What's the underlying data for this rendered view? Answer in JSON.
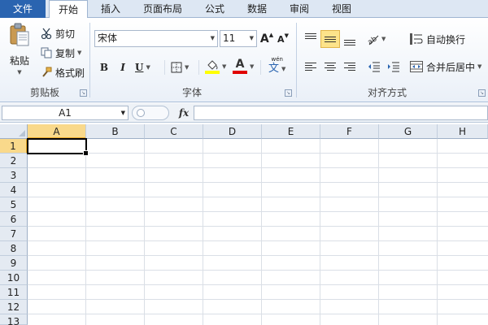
{
  "tabs": [
    {
      "id": "file",
      "label": "文件"
    },
    {
      "id": "home",
      "label": "开始"
    },
    {
      "id": "insert",
      "label": "插入"
    },
    {
      "id": "layout",
      "label": "页面布局"
    },
    {
      "id": "formula",
      "label": "公式"
    },
    {
      "id": "data",
      "label": "数据"
    },
    {
      "id": "review",
      "label": "审阅"
    },
    {
      "id": "view",
      "label": "视图"
    }
  ],
  "clipboard": {
    "paste": "粘贴",
    "cut": "剪切",
    "copy": "复制",
    "format_painter": "格式刷",
    "group_label": "剪贴板"
  },
  "font": {
    "name": "宋体",
    "size": "11",
    "bold": "B",
    "italic": "I",
    "underline": "U",
    "phonetic_top": "wén",
    "phonetic_main": "文",
    "font_color_letter": "A",
    "grow": "A",
    "shrink": "A",
    "group_label": "字体"
  },
  "alignment": {
    "wrap_text": "自动换行",
    "merge_center": "合并后居中",
    "group_label": "对齐方式"
  },
  "formula_bar": {
    "name_box": "A1",
    "fx": "fx",
    "value": ""
  },
  "grid": {
    "columns": [
      "A",
      "B",
      "C",
      "D",
      "E",
      "F",
      "G",
      "H"
    ],
    "rows": [
      "1",
      "2",
      "3",
      "4",
      "5",
      "6",
      "7",
      "8",
      "9",
      "10",
      "11",
      "12",
      "13"
    ],
    "active_cell": "A1"
  },
  "colors": {
    "file_tab": "#2a64b0",
    "highlight": "#ffff00",
    "font_color": "#e00000",
    "selection_header": "#f9d98b"
  }
}
